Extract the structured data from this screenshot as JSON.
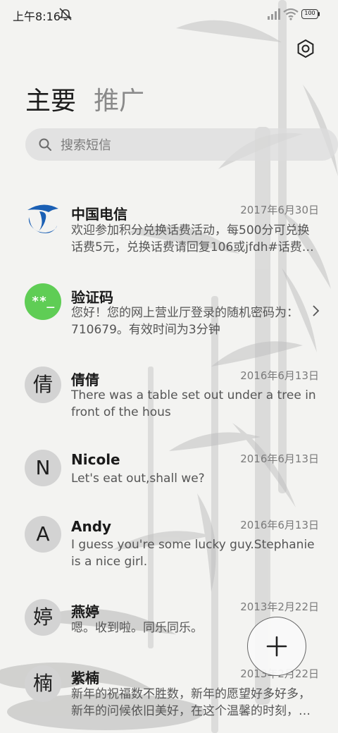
{
  "status_bar": {
    "time": "上午8:16",
    "battery": "100",
    "icons": [
      "mute-icon",
      "signal-icon",
      "wifi-icon",
      "battery-icon"
    ]
  },
  "header": {
    "tabs": [
      {
        "label": "主要",
        "active": true
      },
      {
        "label": "推广",
        "active": false
      }
    ],
    "settings_icon": "settings-hexagon-icon"
  },
  "search": {
    "placeholder": "搜索短信"
  },
  "conversations": [
    {
      "name": "中国电信",
      "date": "2017年6月30日",
      "preview": "欢迎参加积分兑换话费活动，每500分可兑换话费5元，兑换话费请回复106或jfdh#话费…",
      "avatar_type": "logo",
      "avatar_icon": "china-telecom-logo"
    },
    {
      "name": "验证码",
      "date": "",
      "preview": "您好！您的网上营业厅登录的随机密码为：710679。有效时间为3分钟",
      "avatar_type": "code",
      "avatar_text": "**_",
      "avatar_color": "#5fcd55",
      "has_chevron": true
    },
    {
      "name": "倩倩",
      "date": "2016年6月13日",
      "preview": "There was a table set out under a tree in front of the hous",
      "avatar_type": "letter",
      "avatar_text": "倩"
    },
    {
      "name": "Nicole",
      "date": "2016年6月13日",
      "preview": "Let's eat out,shall we?",
      "avatar_type": "letter",
      "avatar_text": "N"
    },
    {
      "name": "Andy",
      "date": "2016年6月13日",
      "preview": "I guess you're some lucky guy.Stephanie is a nice girl.",
      "avatar_type": "letter",
      "avatar_text": "A"
    },
    {
      "name": "燕婷",
      "date": "2013年2月22日",
      "preview": "嗯。收到啦。同乐同乐。",
      "avatar_type": "letter",
      "avatar_text": "婷"
    },
    {
      "name": "紫楠",
      "date": "2013年2月22日",
      "preview": "新年的祝福数不胜数，新年的愿望好多好多，新年的问候依旧美好，在这个温馨的时刻，…",
      "avatar_type": "letter",
      "avatar_text": "楠"
    }
  ],
  "fab": {
    "icon": "plus-icon"
  },
  "colors": {
    "avatar_gray": "#d3d3d3",
    "verification_green": "#5fcd55",
    "telecom_blue": "#1a5fb4"
  }
}
